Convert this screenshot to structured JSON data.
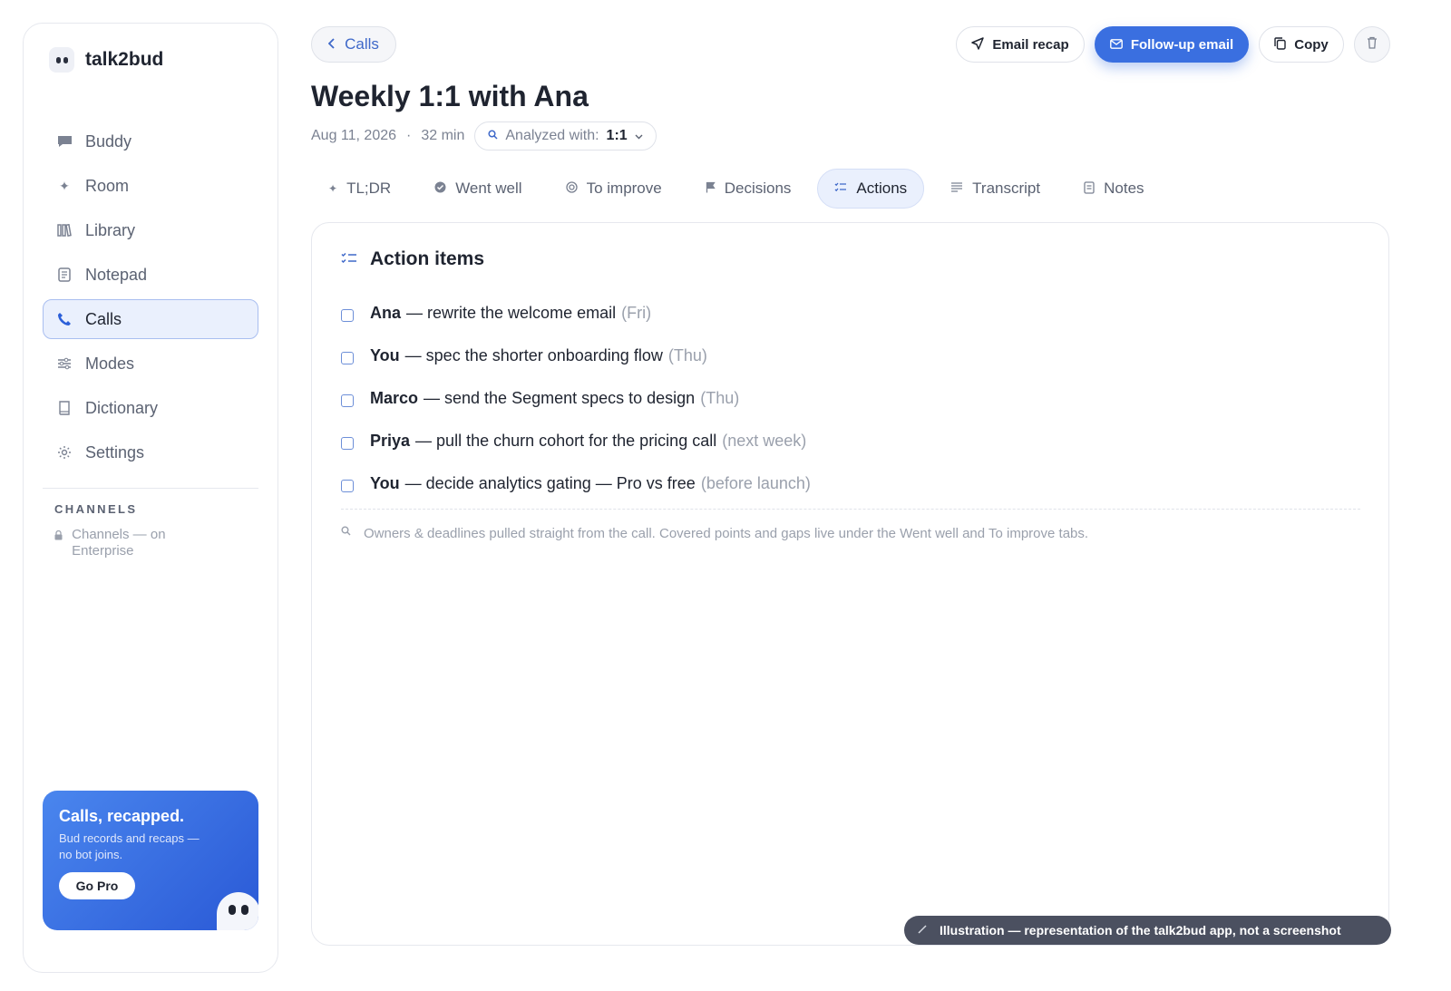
{
  "brand": {
    "name": "talk2bud"
  },
  "sidebar": {
    "items": [
      {
        "label": "Buddy",
        "icon": "chat-icon"
      },
      {
        "label": "Room",
        "icon": "sparkle-icon"
      },
      {
        "label": "Library",
        "icon": "library-icon"
      },
      {
        "label": "Notepad",
        "icon": "notepad-icon"
      },
      {
        "label": "Calls",
        "icon": "phone-icon",
        "active": true
      },
      {
        "label": "Modes",
        "icon": "sliders-icon"
      },
      {
        "label": "Dictionary",
        "icon": "book-icon"
      },
      {
        "label": "Settings",
        "icon": "gear-icon"
      }
    ],
    "channels_title": "CHANNELS",
    "channels_note": "Channels — on Enterprise"
  },
  "promo": {
    "title": "Calls, recapped.",
    "text": "Bud records and recaps — no bot joins.",
    "button": "Go Pro"
  },
  "header": {
    "back_label": "Calls",
    "email_recap": "Email recap",
    "follow_up": "Follow-up email",
    "copy": "Copy",
    "accent": "#3a6fe0"
  },
  "call": {
    "title": "Weekly 1:1 with Ana",
    "date": "Aug 11, 2026",
    "duration": "32 min",
    "analyzed_label": "Analyzed with:",
    "analyzed_value": "1:1"
  },
  "tabs": [
    {
      "label": "TL;DR",
      "icon": "sparkle-icon"
    },
    {
      "label": "Went well",
      "icon": "check-circle-icon"
    },
    {
      "label": "To improve",
      "icon": "target-icon"
    },
    {
      "label": "Decisions",
      "icon": "flag-icon"
    },
    {
      "label": "Actions",
      "icon": "checklist-icon",
      "active": true
    },
    {
      "label": "Transcript",
      "icon": "lines-icon"
    },
    {
      "label": "Notes",
      "icon": "note-icon"
    }
  ],
  "actions": {
    "title": "Action items",
    "items": [
      {
        "owner": "Ana",
        "task": "— rewrite the welcome email",
        "when": "(Fri)"
      },
      {
        "owner": "You",
        "task": "— spec the shorter onboarding flow",
        "when": "(Thu)"
      },
      {
        "owner": "Marco",
        "task": "— send the Segment specs to design",
        "when": "(Thu)"
      },
      {
        "owner": "Priya",
        "task": "— pull the churn cohort for the pricing call",
        "when": "(next week)"
      },
      {
        "owner": "You",
        "task": "— decide analytics gating — Pro vs free",
        "when": "(before launch)"
      }
    ],
    "footnote": "Owners & deadlines pulled straight from the call. Covered points and gaps live under the Went well and To improve tabs."
  },
  "toast": {
    "text": "Illustration — representation of the talk2bud app, not a screenshot"
  }
}
